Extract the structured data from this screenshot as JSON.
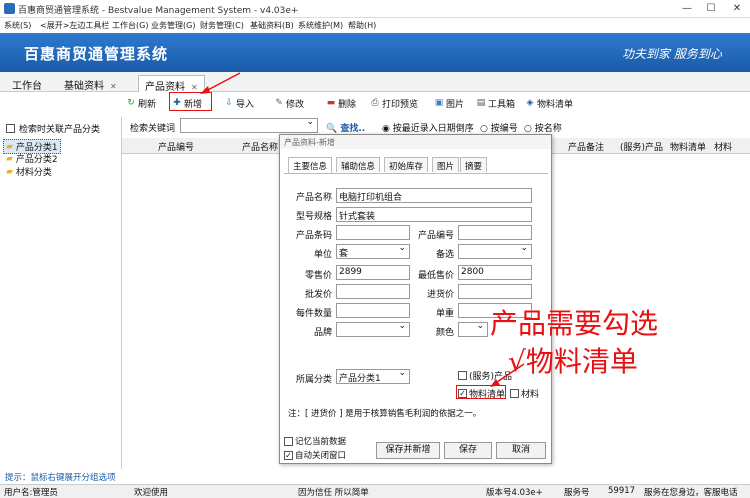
{
  "window": {
    "title": "百惠商贸通管理系统 - Bestvalue Management System - v4.03e+",
    "minimize": "—",
    "maximize": "☐",
    "close": "✕"
  },
  "menu": [
    "系统(S)",
    "<展开>左边工具栏",
    "工作台(G)",
    "业务管理(G)",
    "财务管理(C)",
    "基础资料(B)",
    "系统维护(M)",
    "帮助(H)"
  ],
  "banner": {
    "title": "百惠商贸通管理系统",
    "slogan": "功夫到家 服务到心"
  },
  "tabs": {
    "workbench": "工作台",
    "basic": "基础资料",
    "product": "产品资料",
    "close_x": "✕"
  },
  "toolbar": {
    "refresh": "刷新",
    "add": "新增",
    "import": "导入",
    "edit": "修改",
    "delete": "删除",
    "print": "打印预览",
    "image": "图片",
    "tools": "工具箱",
    "bom": "物料清单"
  },
  "left": {
    "search_related": "检索时关联产品分类",
    "tree": [
      "产品分类1",
      "产品分类2",
      "材料分类"
    ]
  },
  "search": {
    "keyword_label": "检索关键词",
    "find": "查找..",
    "sort_options": [
      "按最近录入日期倒序",
      "按编号",
      "按名称"
    ],
    "sort_selected": 0
  },
  "grid": {
    "columns": [
      "产品编号",
      "产品名称",
      "产品备注",
      "(服务)产品",
      "物料清单",
      "材料"
    ]
  },
  "dialog": {
    "title": "产品资料-新增",
    "tabs": [
      "主要信息",
      "辅助信息",
      "初始库存",
      "图片",
      "摘要"
    ],
    "fields": {
      "name": {
        "label": "产品名称",
        "value": "电脑打印机组合"
      },
      "spec": {
        "label": "型号规格",
        "value": "针式套装"
      },
      "barcode": {
        "label": "产品条码",
        "value": ""
      },
      "code": {
        "label": "产品编号",
        "value": ""
      },
      "unit": {
        "label": "单位",
        "value": "套"
      },
      "spare": {
        "label": "备选",
        "value": ""
      },
      "retail": {
        "label": "零售价",
        "value": "2899"
      },
      "min_price": {
        "label": "最低售价",
        "value": "2800"
      },
      "wholesale": {
        "label": "批发价",
        "value": ""
      },
      "purchase": {
        "label": "进货价",
        "value": ""
      },
      "per_qty": {
        "label": "每件数量",
        "value": ""
      },
      "weight": {
        "label": "单重",
        "value": ""
      },
      "brand": {
        "label": "品牌",
        "value": ""
      },
      "color": {
        "label": "颜色",
        "value": ""
      },
      "category": {
        "label": "所属分类",
        "value": "产品分类1"
      }
    },
    "checks": {
      "service": {
        "label": "(服务)产品",
        "checked": false
      },
      "bom": {
        "label": "物料清单",
        "checked": true
      },
      "material": {
        "label": "材料",
        "checked": false
      }
    },
    "note": "注：[ 进货价 ] 是用于核算销售毛利润的依据之一。",
    "remember": {
      "label": "记忆当前数据",
      "checked": false
    },
    "autoclose": {
      "label": "自动关闭窗口",
      "checked": true
    },
    "buttons": {
      "save_add": "保存并新增",
      "save": "保存",
      "cancel": "取消"
    }
  },
  "annotation": {
    "line1": "产品需要勾选",
    "line2": "√物料清单",
    "color": "#e81010"
  },
  "hint": "提示：鼠标右键展开分组选项",
  "status": {
    "user": "用户名:管理员",
    "welcome": "欢迎使用",
    "motto": "因为信任 所以简单",
    "version": "版本号4.03e+",
    "service_label": "服务号",
    "service_no": "59917",
    "tagline": "服务在您身边，客服电话"
  }
}
